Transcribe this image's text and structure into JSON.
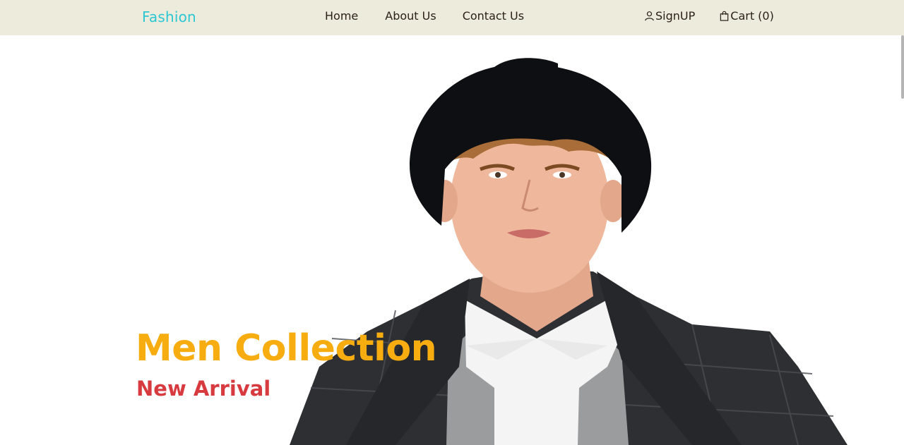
{
  "brand": {
    "name": "Fashion"
  },
  "nav": {
    "home": "Home",
    "about": "About Us",
    "contact": "Contact Us"
  },
  "account": {
    "signup": "SignUP",
    "cart": "Cart (0)"
  },
  "hero": {
    "title": "Men Collection",
    "subtitle": "New Arrival",
    "image": "male model wearing black beret, white shirt, grey cardigan and dark check blazer"
  },
  "colors": {
    "navbar_bg": "#ecebdc",
    "brand": "#2cc7d3",
    "title": "#f7ad0f",
    "subtitle": "#d83b3f"
  },
  "icons": {
    "signup": "user-icon",
    "cart": "shopping-bag-icon"
  }
}
